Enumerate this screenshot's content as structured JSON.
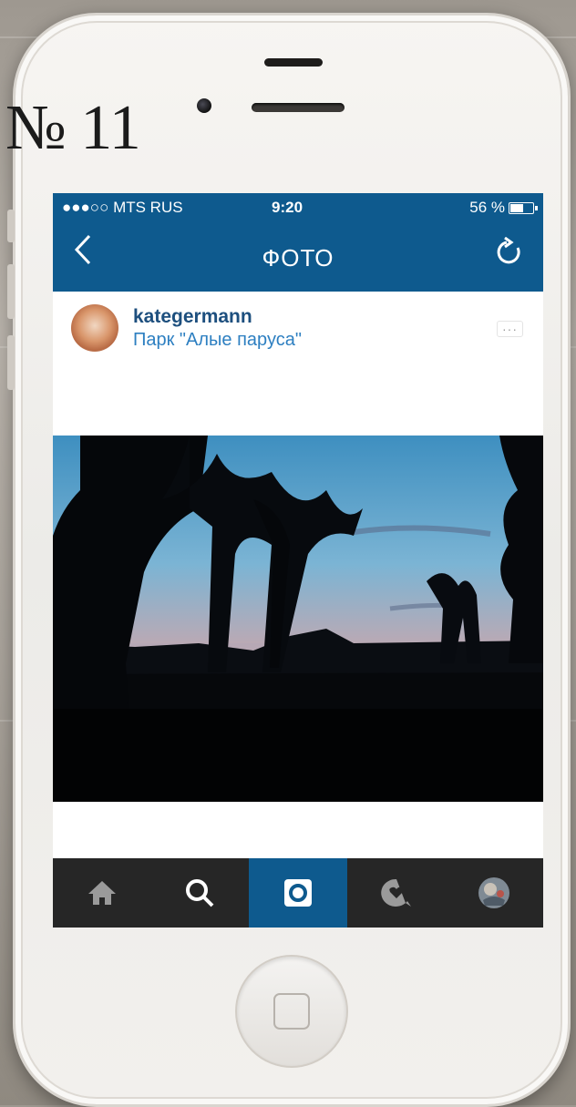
{
  "issue_label": "№ 11",
  "status_bar": {
    "carrier": "●●●○○ MTS RUS",
    "time": "9:20",
    "battery": "56 %"
  },
  "navbar": {
    "title": "ФОТО",
    "back_icon": "chevron-left-icon",
    "refresh_icon": "refresh-icon"
  },
  "post": {
    "username": "kategermann",
    "location": "Парк \"Алые паруса\"",
    "more_label": "···"
  },
  "tabbar": {
    "tabs": [
      {
        "icon": "home-icon",
        "active": false
      },
      {
        "icon": "search-icon",
        "active": false
      },
      {
        "icon": "camera-icon",
        "active": true
      },
      {
        "icon": "heart-bubble-icon",
        "active": false
      },
      {
        "icon": "profile-avatar-icon",
        "active": false
      }
    ]
  },
  "colors": {
    "accent": "#0e5a8e",
    "username": "#1d4f7e",
    "location": "#2d7fc1",
    "tabbar_bg": "#262626"
  }
}
